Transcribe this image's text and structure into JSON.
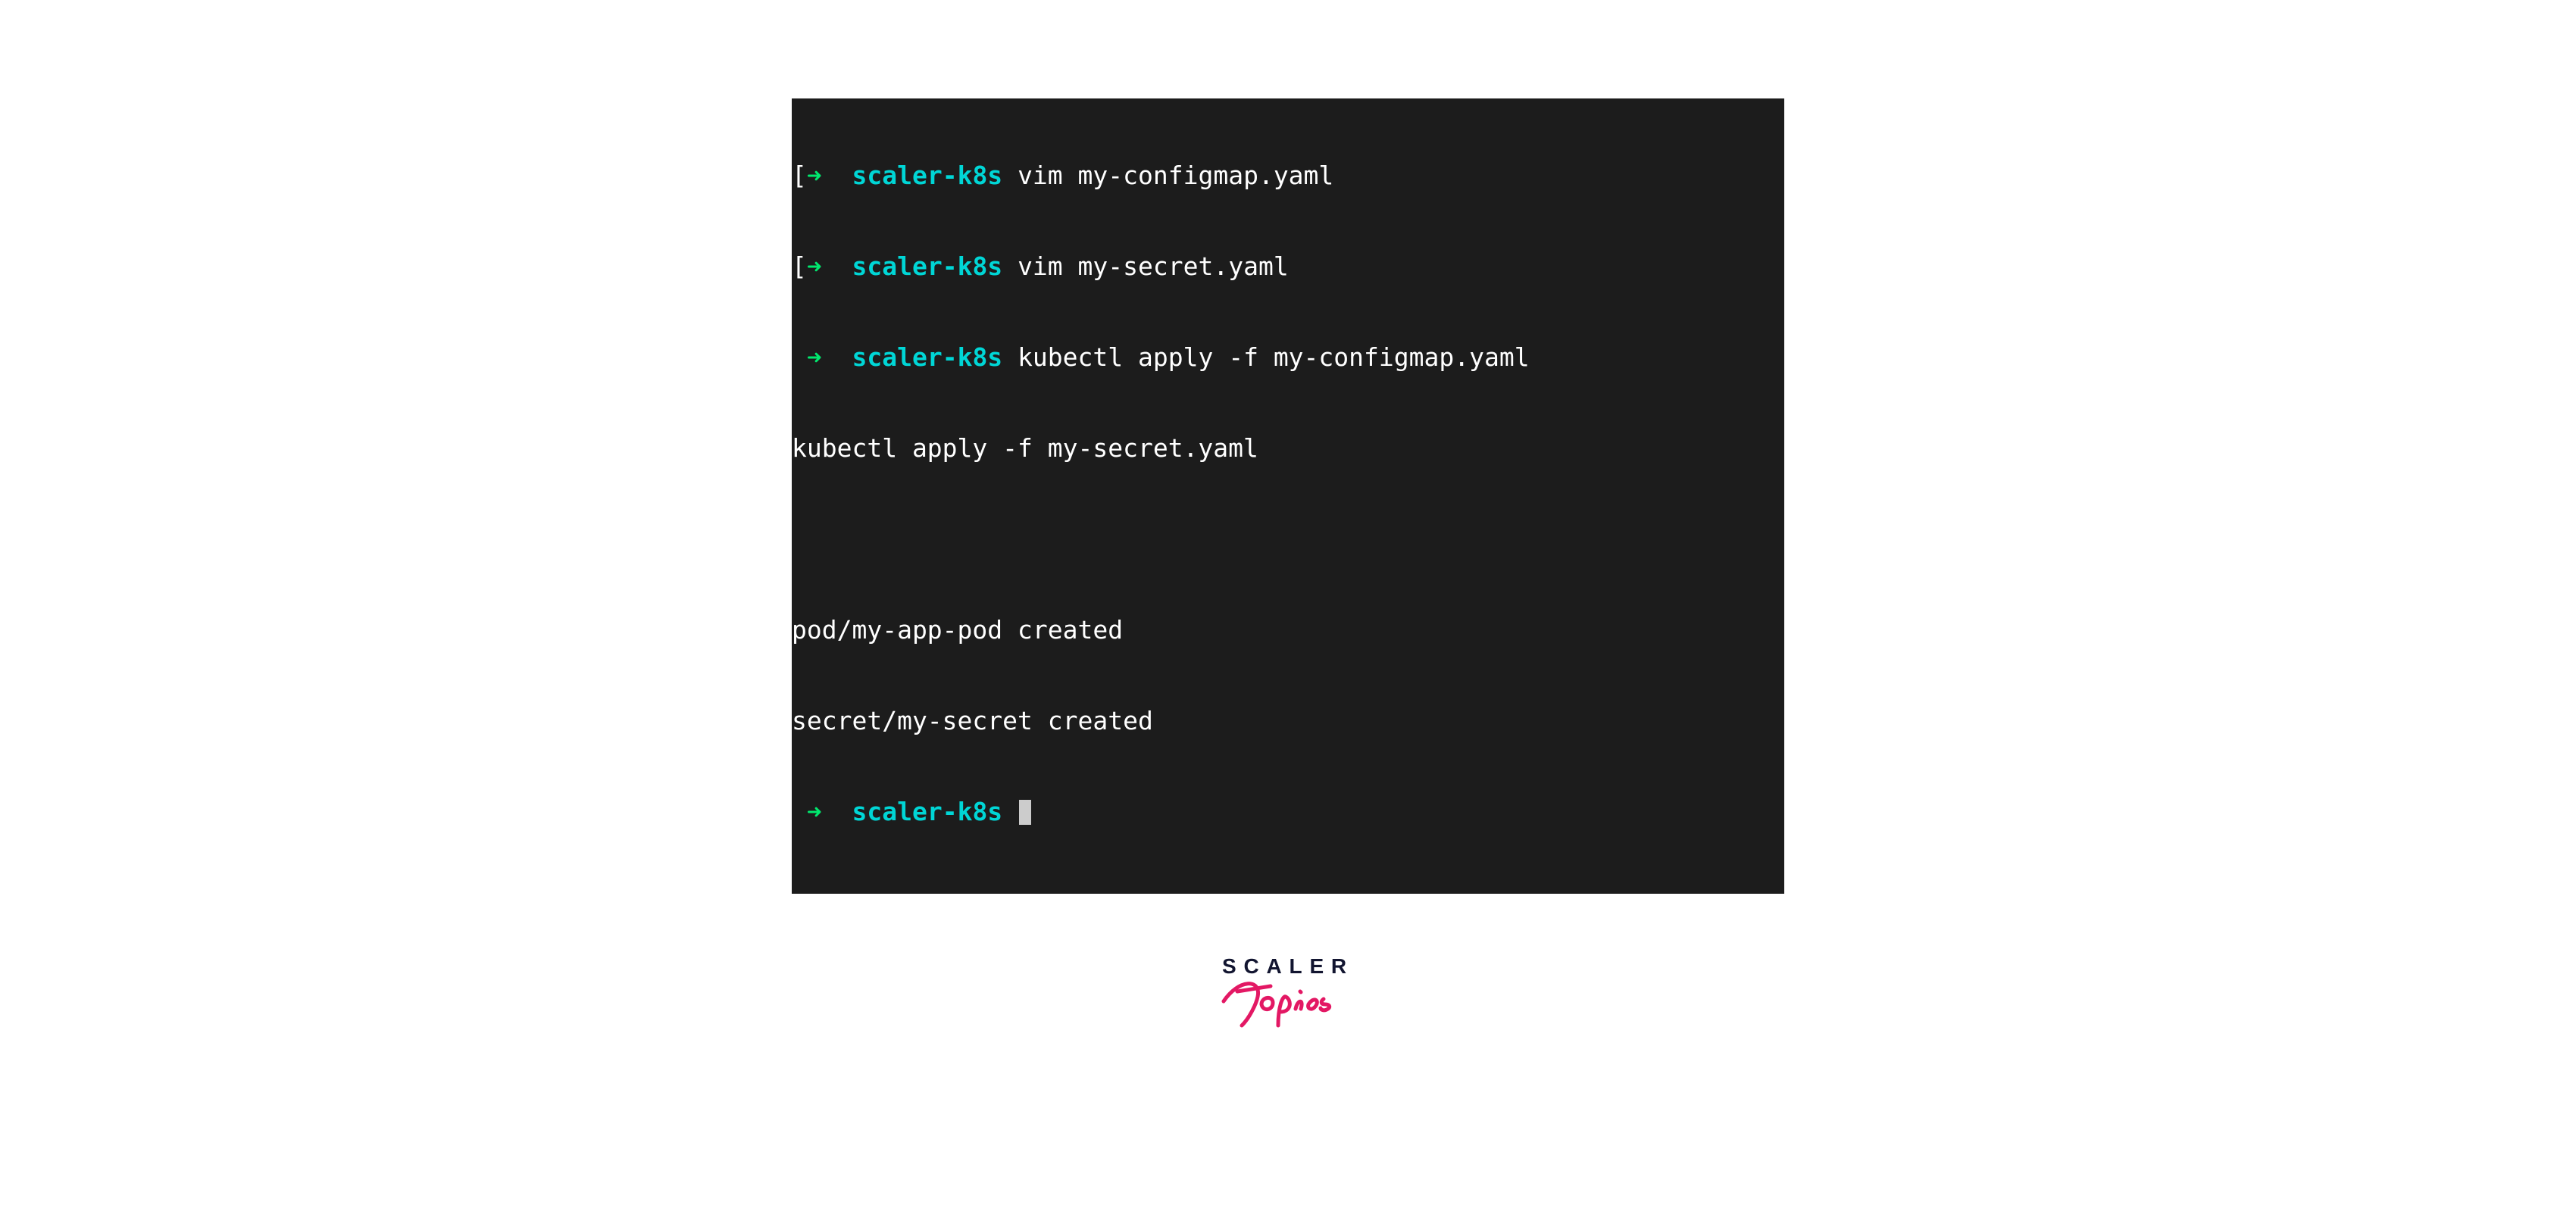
{
  "terminal": {
    "lines": [
      {
        "type": "prompt",
        "bracket": "[",
        "arrow": "➜",
        "dir": "scaler-k8s",
        "cmd": "vim my-configmap.yaml"
      },
      {
        "type": "prompt",
        "bracket": "[",
        "arrow": "➜",
        "dir": "scaler-k8s",
        "cmd": "vim my-secret.yaml"
      },
      {
        "type": "prompt",
        "bracket": "",
        "arrow": "➜",
        "dir": "scaler-k8s",
        "cmd": "kubectl apply -f my-configmap.yaml"
      },
      {
        "type": "output",
        "text": "kubectl apply -f my-secret.yaml"
      },
      {
        "type": "blank"
      },
      {
        "type": "output",
        "text": "pod/my-app-pod created"
      },
      {
        "type": "output",
        "text": "secret/my-secret created"
      },
      {
        "type": "prompt_cursor",
        "bracket": "",
        "arrow": "➜",
        "dir": "scaler-k8s",
        "cmd": ""
      }
    ]
  },
  "logo": {
    "brand": "SCALER",
    "sub": "Topics"
  }
}
